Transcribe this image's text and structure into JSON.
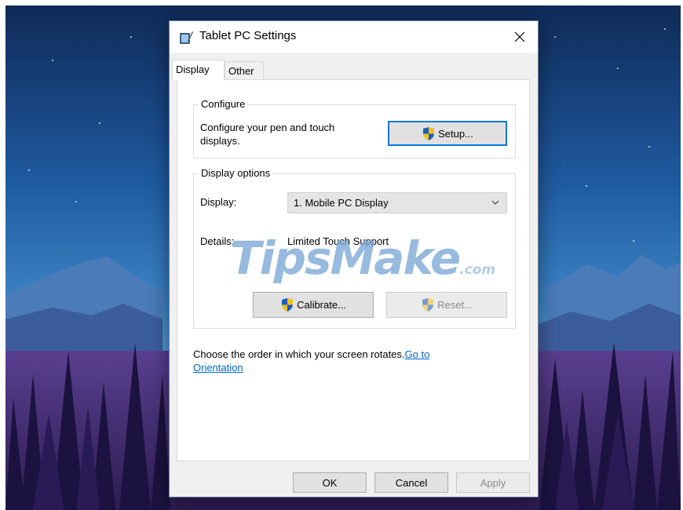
{
  "window": {
    "title": "Tablet PC Settings",
    "icon": "tablet-settings-icon"
  },
  "tabs": [
    {
      "label": "Display",
      "selected": true
    },
    {
      "label": "Other",
      "selected": false
    }
  ],
  "configure": {
    "group_label": "Configure",
    "description_line1": "Configure your pen and touch",
    "description_line2": "displays.",
    "setup_button_label": "Setup...",
    "setup_button_mnemonic_index": 0
  },
  "display_options": {
    "group_label": "Display options",
    "display_label": "Display:",
    "display_selected": "1. Mobile PC Display",
    "details_label": "Details:",
    "details_value": "Limited Touch Support",
    "calibrate_button_label": "Calibrate...",
    "reset_button_label": "Reset..."
  },
  "orientation": {
    "text": "Choose the order in which your screen rotates.",
    "link_part1": "Go to",
    "link_part2": "Orientation"
  },
  "footer": {
    "ok_label": "OK",
    "cancel_label": "Cancel",
    "apply_label": "Apply"
  },
  "watermark": {
    "main": "TipsMake",
    "suffix": ".com"
  },
  "colors": {
    "accent": "#0078d7",
    "link": "#0066cc",
    "dialog_bg": "#f0f0f0",
    "watermark": "#7aa7d6"
  }
}
